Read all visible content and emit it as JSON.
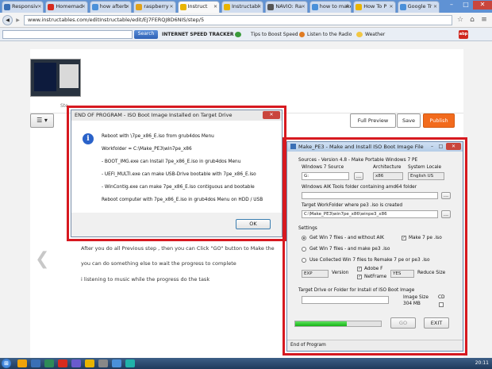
{
  "browser": {
    "tabs": [
      {
        "label": "Responsiv",
        "color": "#3a6fb5"
      },
      {
        "label": "Homemad",
        "color": "#d62b1f"
      },
      {
        "label": "how afterb",
        "color": "#4a90d9"
      },
      {
        "label": "raspberry",
        "color": "#e0a21b"
      },
      {
        "label": "Instruct",
        "color": "#e8b400",
        "active": true
      },
      {
        "label": "Instructabl",
        "color": "#e8b400"
      },
      {
        "label": "NAVIO: Ra",
        "color": "#555555"
      },
      {
        "label": "how to make instructables post",
        "color": "#4a90d9"
      },
      {
        "label": "How To P",
        "color": "#e8b400"
      },
      {
        "label": "Google Tr",
        "color": "#4a90d9"
      }
    ],
    "window_controls": {
      "minimize": "–",
      "maximize": "□",
      "close": "✕"
    },
    "url": "www.instructables.com/editInstructable/edit/EJ7FERQJ8D6NIS/step/5",
    "search": {
      "value": "",
      "button": "Search"
    },
    "toolbar_links": [
      "INTERNET SPEED TRACKER",
      "Tips to Boost Speed",
      "Listen to the Radio",
      "Weather"
    ],
    "badge": "abp",
    "nav_glyphs": {
      "back": "◀",
      "forward": "▶",
      "star": "☆",
      "home": "⌂",
      "menu": "≡"
    }
  },
  "editor": {
    "step_title_placeholder": "Ste",
    "buttons": {
      "full_preview": "Full Preview",
      "save": "Save",
      "publish": "Publish"
    },
    "body_lines": [
      "After you do all Previous step , then you can Click \"GO\" button to Make the",
      "you can do something else to wait the progress to complete",
      "i listening to music while the progress do the task"
    ],
    "prev_arrow": "❮",
    "accent": "#f26b1d"
  },
  "message_box": {
    "title": "END OF PROGRAM - ISO Boot Image Installed on Target Drive",
    "close": "✕",
    "lines": [
      "Reboot with \\7pe_x86_E.iso from grub4dos Menu",
      "Workfolder = C:\\Make_PE3\\win7pe_x86",
      "- BOOT_IMG.exe can Install 7pe_x86_E.iso in grub4dos Menu",
      "- UEFI_MULTI.exe can make USB-Drive bootable with 7pe_x86_E.iso",
      "- WinContig.exe can make 7pe_x86_E.iso contiguous and bootable",
      "Reboot computer with 7pe_x86_E.iso in grub4dos Menu on HDD / USB"
    ],
    "ok": "OK",
    "info_glyph": "i"
  },
  "make_pe3": {
    "title": "Make_PE3 - Make and Install ISO Boot Image File",
    "title_controls": {
      "minimize": "–",
      "maximize": "□",
      "close": "✕"
    },
    "sources_heading": "Sources - Version 4.8 - Make Portable Windows 7 PE",
    "col_source": "Windows 7 Source",
    "col_arch": "Architecture",
    "col_locale": "System Locale",
    "source_value": "G:",
    "arch_value": "x86",
    "locale_value": "English US",
    "aik_label": "Windows AIK Tools folder containing  amd64  folder",
    "target_label": "Target WorkFolder where pe3 .iso is created",
    "target_value": "C:\\Make_PE3\\win7pe_x86\\winpe3_x86",
    "settings_heading": "Settings",
    "options": [
      {
        "label": "Get Win 7 files -  and without  AIK",
        "selected": true
      },
      {
        "label": "Get Win 7 files -  and make pe3 .iso",
        "selected": false
      },
      {
        "label": "Use Collected Win 7 files  to  Remake  7 pe or pe3 .iso",
        "selected": false
      }
    ],
    "check_make7pe": "Make 7 pe .iso",
    "check_adobe": "Adobe F",
    "check_netframe": "NetFrame",
    "version_combo": "EXP",
    "version_label": "Version",
    "reduce_combo": "YES",
    "reduce_label": "Reduce Size",
    "drive_label": "Target Drive or Folder for Install of ISO Boot Image",
    "image_size_label": "Image Size",
    "image_size_value": "304 MB",
    "cd_label": "CD",
    "progress": 0.6,
    "go": "GO",
    "exit": "EXIT",
    "status": "End of Program",
    "browse": "..."
  },
  "taskbar": {
    "clock": "20:11",
    "start_glyph": "⊞",
    "apps": [
      "#f0a30a",
      "#3a6fb5",
      "#2e8b57",
      "#d62b1f",
      "#6a5acd",
      "#e8b400",
      "#888888",
      "#4a90d9",
      "#20b2aa"
    ]
  }
}
